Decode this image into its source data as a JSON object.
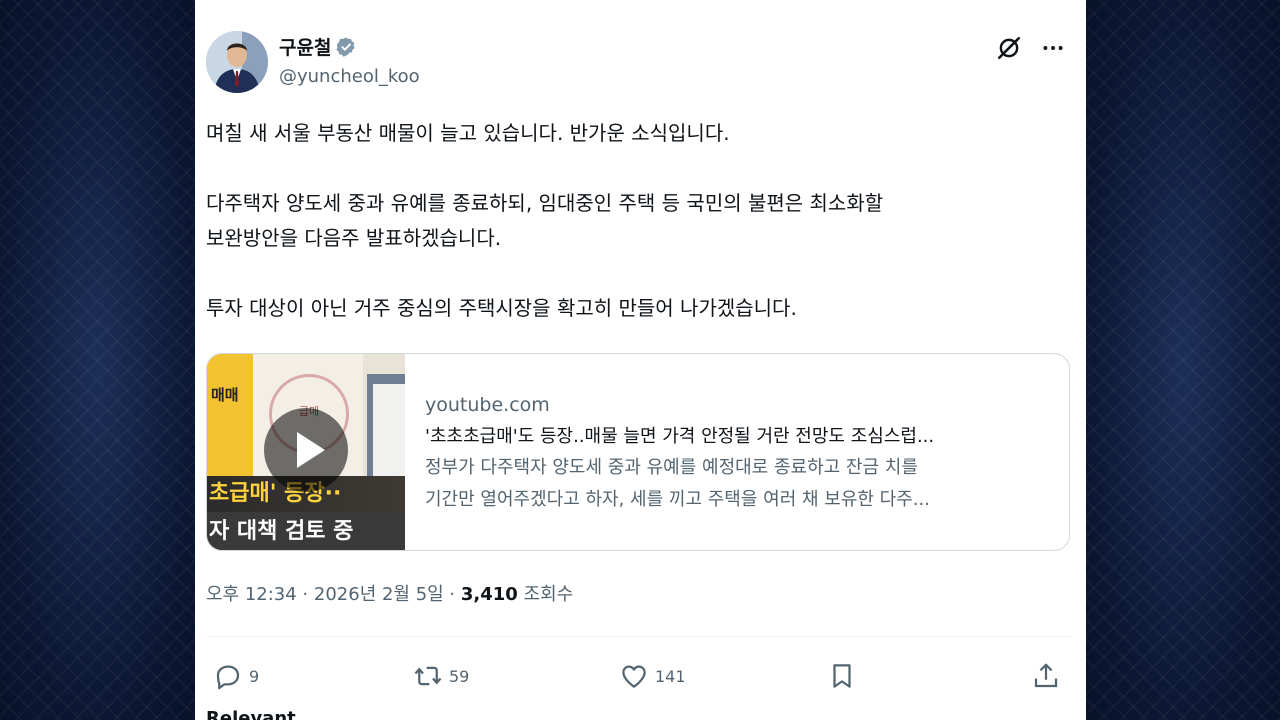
{
  "author": {
    "name": "구윤철",
    "handle": "@yuncheol_koo",
    "verified_icon": "verified-badge-icon"
  },
  "tweet": {
    "body": "며칠 새 서울 부동산 매물이 늘고 있습니다. 반가운 소식입니다.\n\n다주택자 양도세 중과 유예를 종료하되, 임대중인 주택 등 국민의 불편은 최소화할\n보완방안을 다음주 발표하겠습니다.\n\n투자 대상이 아닌 거주 중심의 주택시장을 확고히 만들어 나가겠습니다."
  },
  "link_card": {
    "domain": "youtube.com",
    "title": "'초초초급매'도 등장..매물 늘면 가격 안정될 거란 전망도 조심스럽...",
    "description_line1": "정부가 다주택자 양도세 중과 유예를 예정대로 종료하고 잔금 치를",
    "description_line2": "기간만 열어주겠다고 하자, 세를 끼고 주택을 여러 채 보유한 다주...",
    "thumb": {
      "side_text": "매매",
      "stamp_text": "급매",
      "band1": "초급매' 등장··",
      "band2": "자 대책 검토 중"
    }
  },
  "meta": {
    "time_date": "오후 12:34 · 2026년 2월 5일 · ",
    "views": "3,410",
    "views_label": " 조회수"
  },
  "actions": {
    "replies": "9",
    "retweets": "59",
    "likes": "141"
  },
  "section": {
    "relevant": "Relevant"
  },
  "colors": {
    "text_primary": "#0f1419",
    "text_secondary": "#536471",
    "border": "#cfd9de",
    "background_outer": "#0b1733"
  }
}
